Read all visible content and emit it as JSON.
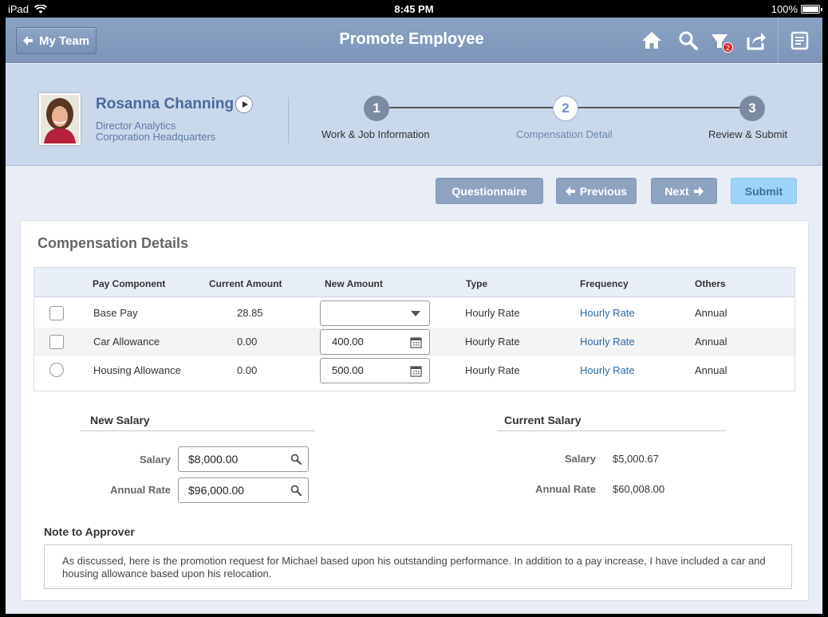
{
  "status_bar": {
    "device": "iPad",
    "time": "8:45 PM",
    "battery": "100%"
  },
  "header": {
    "back_label": "My Team",
    "title": "Promote Employee",
    "notification_count": "2",
    "icons": [
      "home-icon",
      "search-icon",
      "notifications-icon",
      "share-icon",
      "notes-icon"
    ]
  },
  "employee": {
    "name": "Rosanna Channing",
    "title": "Director Analytics",
    "location": "Corporation Headquarters"
  },
  "steps": [
    {
      "number": "1",
      "label": "Work & Job Information",
      "active": false
    },
    {
      "number": "2",
      "label": "Compensation Detail",
      "active": true
    },
    {
      "number": "3",
      "label": "Review & Submit",
      "active": false
    }
  ],
  "actions": {
    "questionnaire": "Questionnaire",
    "previous": "Previous",
    "next": "Next",
    "submit": "Submit"
  },
  "compensation": {
    "title": "Compensation Details",
    "columns": [
      "Pay Component",
      "Current Amount",
      "New Amount",
      "Type",
      "Frequency",
      "Others"
    ],
    "rows": [
      {
        "component": "Base Pay",
        "current": "28.85",
        "new_amount": "",
        "type": "Hourly Rate",
        "frequency": "Hourly Rate",
        "others": "Annual"
      },
      {
        "component": "Car Allowance",
        "current": "0.00",
        "new_amount": "400.00",
        "type": "Hourly Rate",
        "frequency": "Hourly Rate",
        "others": "Annual"
      },
      {
        "component": "Housing Allowance",
        "current": "0.00",
        "new_amount": "500.00",
        "type": "Hourly Rate",
        "frequency": "Hourly Rate",
        "others": "Annual"
      }
    ]
  },
  "new_salary": {
    "title": "New Salary",
    "salary_label": "Salary",
    "salary_value": "$8,000.00",
    "annual_label": "Annual Rate",
    "annual_value": "$96,000.00"
  },
  "current_salary": {
    "title": "Current Salary",
    "salary_label": "Salary",
    "salary_value": "$5,000.67",
    "annual_label": "Annual Rate",
    "annual_value": "$60,008.00"
  },
  "note": {
    "title": "Note to Approver",
    "text": "As discussed, here is the promotion request for Michael based upon his outstanding performance. In addition to a pay increase, I have included a car and housing allowance based upon his relocation."
  },
  "colors": {
    "header": "#8aa3c4",
    "profile_band": "#c9d8eb",
    "link": "#2a6aa8",
    "submit": "#9ed4f7",
    "badge": "#d8262b"
  }
}
